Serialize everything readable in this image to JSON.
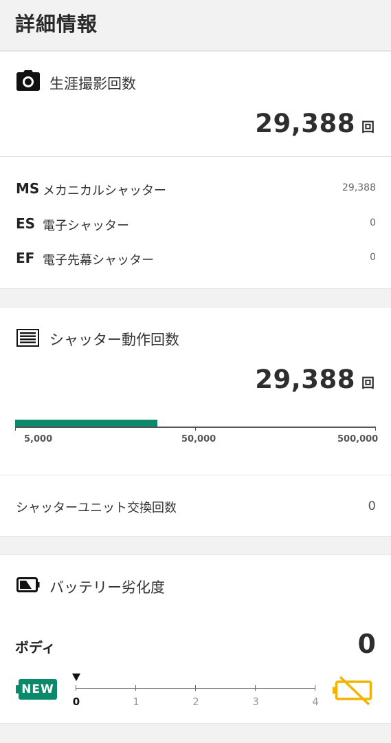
{
  "header": {
    "title": "詳細情報"
  },
  "lifetime_shots": {
    "title": "生涯撮影回数",
    "icon": "camera-icon",
    "total": "29,388",
    "unit": "回"
  },
  "shutter_breakdown": [
    {
      "code": "MS",
      "label": "メカニカルシャッター",
      "value": "29,388"
    },
    {
      "code": "ES",
      "label": "電子シャッター",
      "value": "0"
    },
    {
      "code": "EF",
      "label": "電子先幕シャッター",
      "value": "0"
    }
  ],
  "shutter_actuations": {
    "title": "シャッター動作回数",
    "icon": "shutter-list-icon",
    "total": "29,388",
    "unit": "回",
    "gauge": {
      "value": 29388,
      "scale": "log",
      "labels": [
        "5,000",
        "50,000",
        "500,000"
      ],
      "fill_color": "#0a8a6a"
    },
    "unit_replacement": {
      "label": "シャッターユニット交換回数",
      "value": "0"
    }
  },
  "battery": {
    "title": "バッテリー劣化度",
    "icon": "battery-icon",
    "body_label": "ボディ",
    "body_value": "0",
    "new_badge": "NEW",
    "scale": [
      "0",
      "1",
      "2",
      "3",
      "4"
    ],
    "current_level": 0,
    "end_icon": "battery-degraded-icon",
    "end_icon_color": "#f2b400"
  }
}
